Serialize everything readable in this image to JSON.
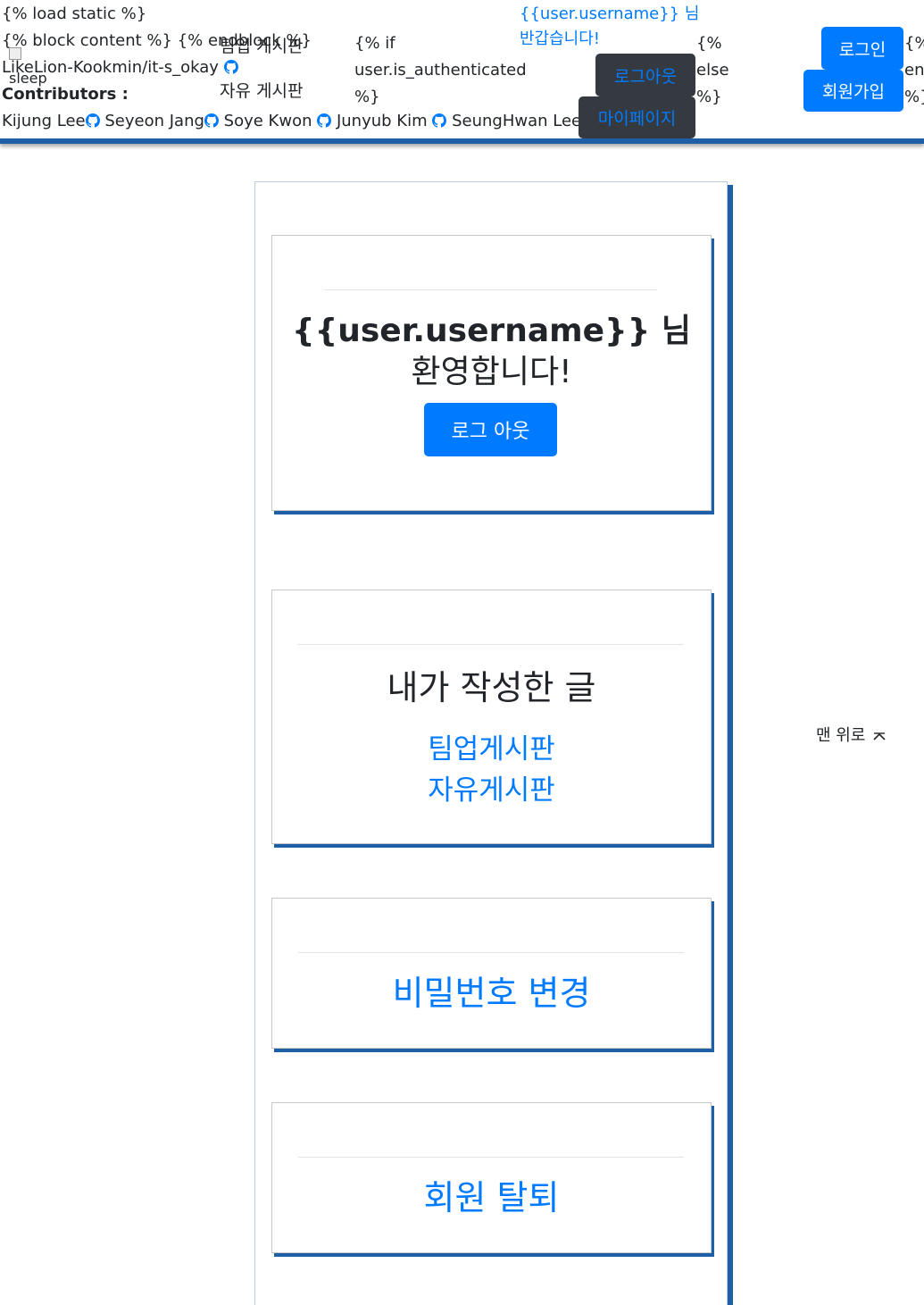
{
  "template": {
    "load_static": "{% load static %}",
    "block_content": "{% block content %} {% endblock %}",
    "logo_alt": "sleep",
    "repo": "LikeLion-Kookmin/it-s_okay",
    "contributors_label": "Contributors :",
    "contributors": [
      "Kijung Lee",
      "Seyeon Jang",
      "Soye Kwon",
      "Junyub Kim",
      "SeungHwan Lee"
    ],
    "if_line1": "{% if",
    "if_line2": "user.is_authenticated",
    "if_line3": "%}",
    "else_line1": "{%",
    "else_line2": "else",
    "else_line3": "%}",
    "endif_line1": "{%",
    "endif_line2": "en",
    "endif_line3": "%}"
  },
  "nav": {
    "teamup_board": "팀업 게시판",
    "free_board": "자유 게시판",
    "greeting_line1": "{{user.username}} 님",
    "greeting_line2": "반갑습니다!",
    "logout": "로그아웃",
    "mypage": "마이페이지",
    "login": "로그인",
    "signup": "회원가입"
  },
  "cards": {
    "welcome_line1": "{{user.username}} 님",
    "welcome_line2": "환영합니다!",
    "logout_button": "로그 아웃",
    "my_posts_title": "내가 작성한 글",
    "my_posts_teamup": "팀업게시판",
    "my_posts_free": "자유게시판",
    "change_password": "비밀번호 변경",
    "withdraw": "회원 탈퇴"
  },
  "scroll_top": {
    "label": "맨 위로",
    "icon": "chevron-up-icon"
  },
  "colors": {
    "accent": "#007bff",
    "dark_button": "#343a40",
    "shadow_blue": "#1f5fa8"
  }
}
